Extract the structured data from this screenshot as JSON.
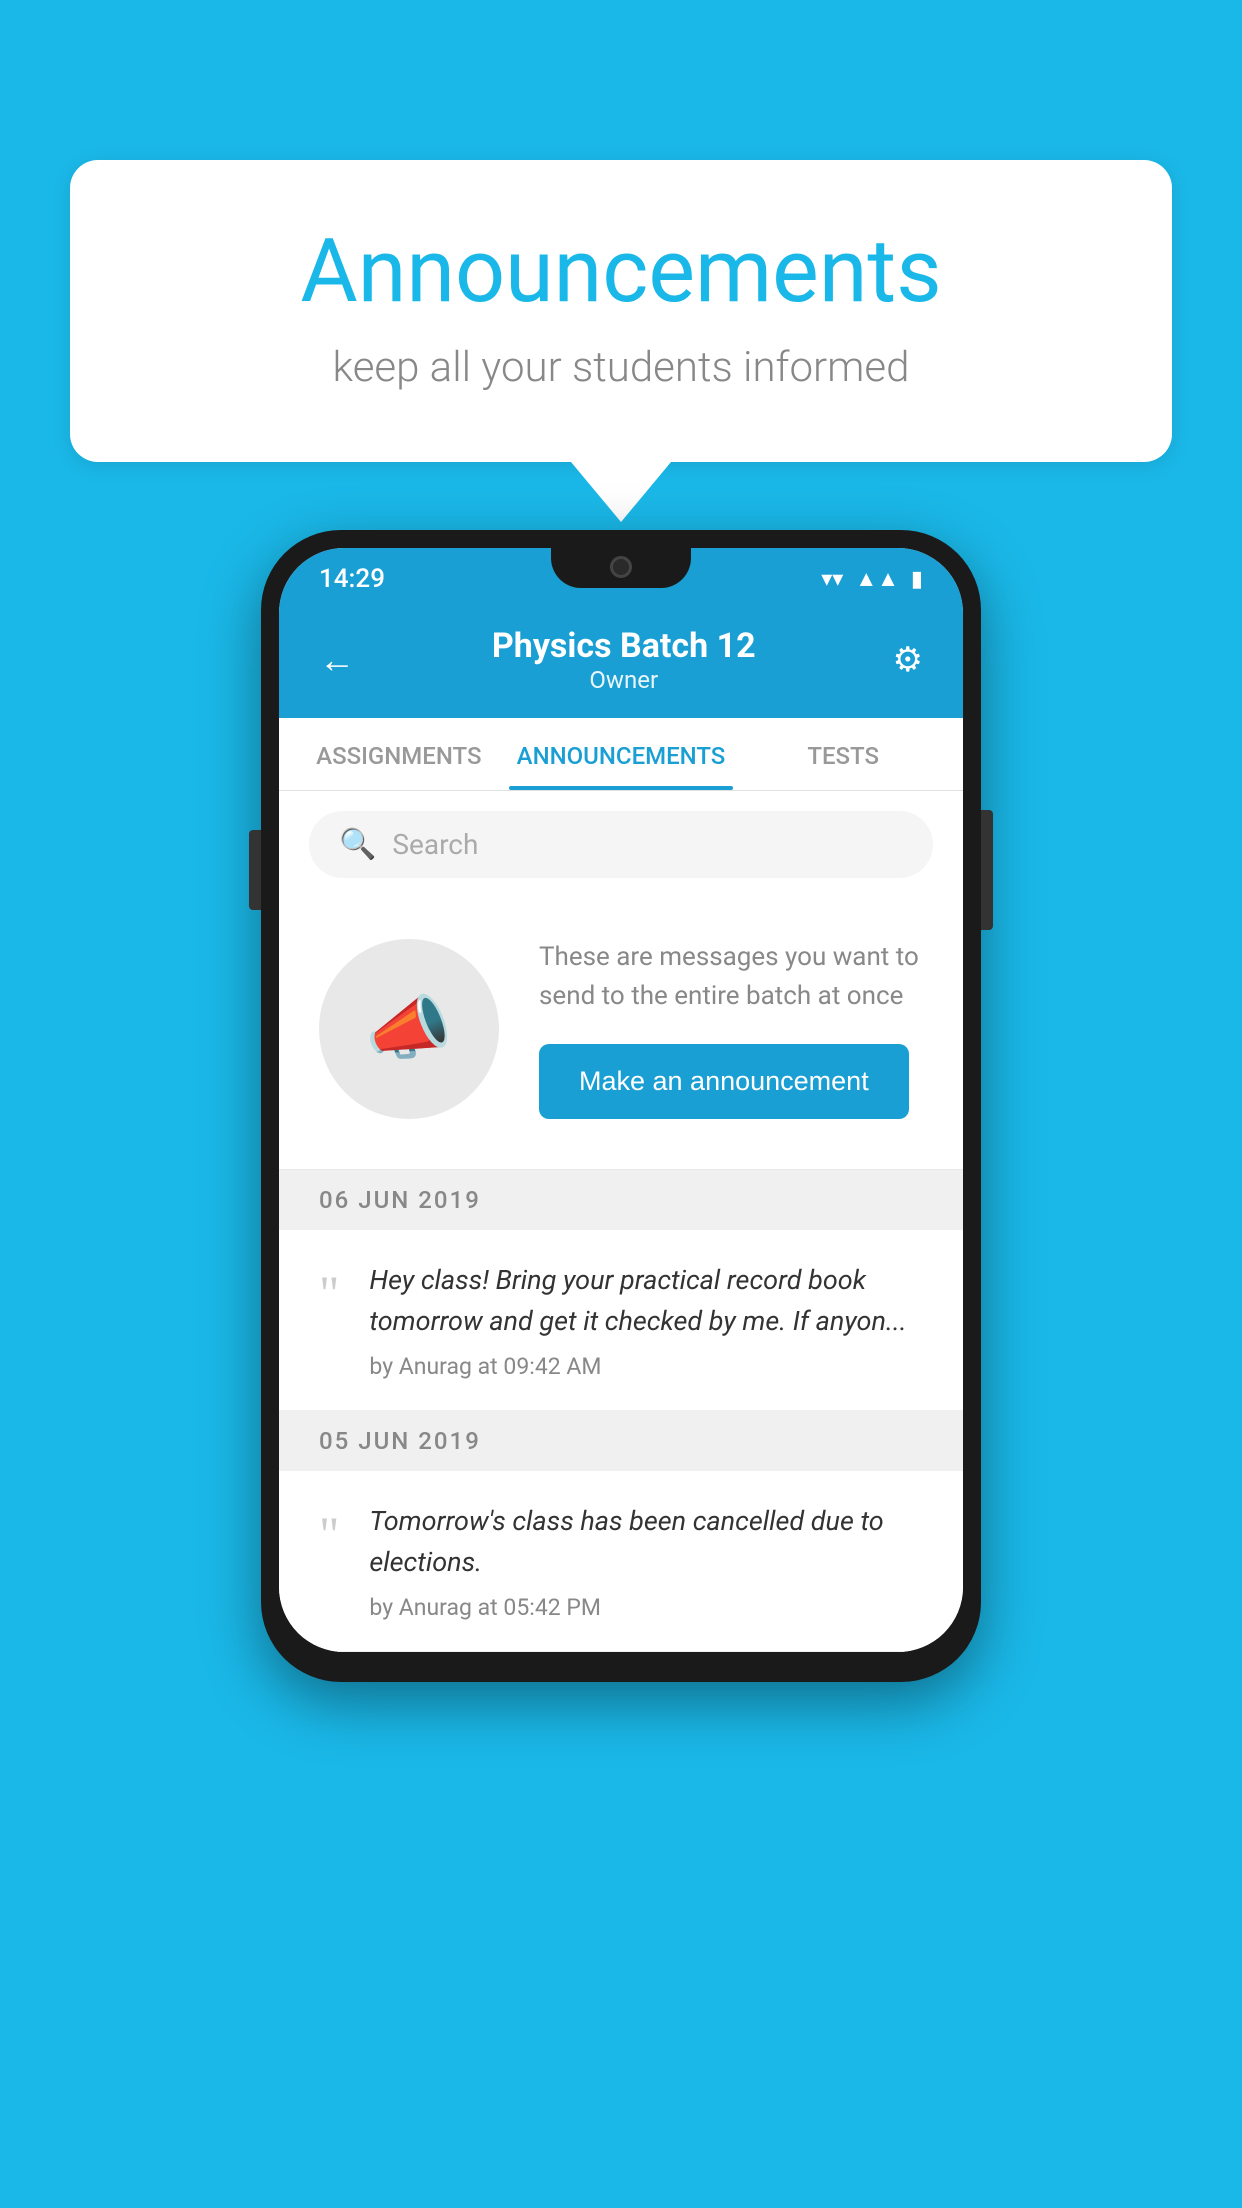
{
  "background_color": "#1ab8e8",
  "speech_bubble": {
    "title": "Announcements",
    "subtitle": "keep all your students informed"
  },
  "phone": {
    "status_bar": {
      "time": "14:29",
      "icons": [
        "wifi",
        "signal",
        "battery"
      ]
    },
    "header": {
      "title": "Physics Batch 12",
      "subtitle": "Owner",
      "back_label": "←",
      "settings_label": "⚙"
    },
    "tabs": [
      {
        "label": "ASSIGNMENTS",
        "active": false
      },
      {
        "label": "ANNOUNCEMENTS",
        "active": true
      },
      {
        "label": "TESTS",
        "active": false
      }
    ],
    "search": {
      "placeholder": "Search"
    },
    "intro": {
      "description": "These are messages you want to send to the entire batch at once",
      "button_label": "Make an announcement"
    },
    "announcements": [
      {
        "date": "06  JUN  2019",
        "text": "Hey class! Bring your practical record book tomorrow and get it checked by me. If anyon...",
        "meta": "by Anurag at 09:42 AM"
      },
      {
        "date": "05  JUN  2019",
        "text": "Tomorrow's class has been cancelled due to elections.",
        "meta": "by Anurag at 05:42 PM"
      }
    ]
  }
}
